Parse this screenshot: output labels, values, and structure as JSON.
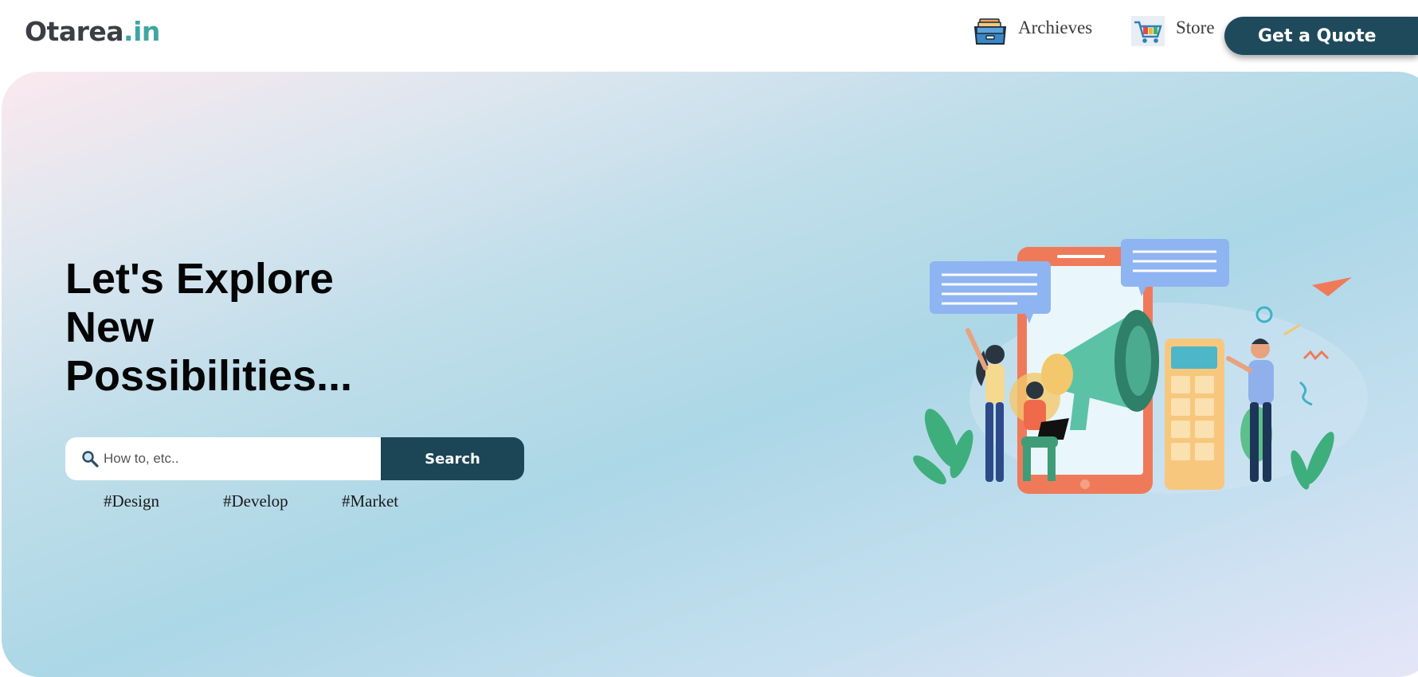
{
  "header": {
    "logo_main": "Otarea",
    "logo_accent": ".in",
    "nav": [
      {
        "label": "Archieves",
        "icon": "archive-drawer-icon"
      },
      {
        "label": "Store",
        "icon": "shopping-cart-icon"
      }
    ],
    "quote_button": "Get a Quote"
  },
  "hero": {
    "title_lines": [
      "Let's Explore",
      "New",
      "Possibilities..."
    ],
    "search": {
      "placeholder": "How to, etc..",
      "value": "",
      "button": "Search",
      "icon": "search-icon"
    },
    "tags": [
      "#Design",
      "#Develop",
      "#Market"
    ],
    "illustration": "marketing-megaphone-illustration"
  },
  "colors": {
    "brand_dark": "#1f4a5c",
    "logo_accent": "#3fa6a3",
    "hero_gradient_start": "#fbe9ee",
    "hero_gradient_mid": "#acd7e6",
    "hero_gradient_end": "#e6e6f8"
  }
}
